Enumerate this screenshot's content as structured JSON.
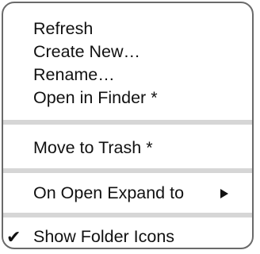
{
  "menu": {
    "group1": {
      "refresh": "Refresh",
      "create_new": "Create New…",
      "rename": "Rename…",
      "open_in_finder": "Open in Finder *"
    },
    "group2": {
      "move_to_trash": "Move to Trash *"
    },
    "group3": {
      "on_open_expand_to": "On Open Expand to",
      "submenu_icon": "triangle-right-icon"
    },
    "group4": {
      "show_folder_icons": "Show Folder Icons",
      "show_folder_icons_checked": true,
      "check_glyph": "✔"
    }
  }
}
